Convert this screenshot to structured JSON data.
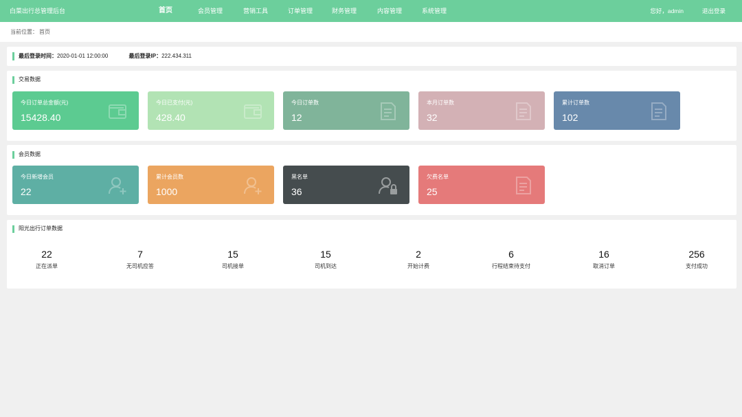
{
  "app": {
    "title": "白菜出行总管理后台"
  },
  "nav": {
    "items": [
      {
        "label": "首页",
        "active": true
      },
      {
        "label": "会员管理"
      },
      {
        "label": "营销工具"
      },
      {
        "label": "订单管理"
      },
      {
        "label": "财务管理"
      },
      {
        "label": "内容管理"
      },
      {
        "label": "系统管理"
      }
    ]
  },
  "user": {
    "greeting": "您好，admin",
    "logout": "退出登录"
  },
  "breadcrumb": {
    "label": "当前位置：",
    "current": "首页"
  },
  "login_info": {
    "time_label": "最后登录时间：",
    "time_value": "2020-01-01 12:00:00",
    "ip_label": "最后登录IP：",
    "ip_value": "222.434.311"
  },
  "trade": {
    "title": "交易数据",
    "cards": [
      {
        "label": "今日订单总金额(元)",
        "value": "15428.40",
        "color": "#5ccb91",
        "icon": "wallet-icon"
      },
      {
        "label": "今日已支付(元)",
        "value": "428.40",
        "color": "#b2e3b4",
        "icon": "wallet-icon"
      },
      {
        "label": "今日订单数",
        "value": "12",
        "color": "#80b49a",
        "icon": "document-icon"
      },
      {
        "label": "本月订单数",
        "value": "32",
        "color": "#d3b1b5",
        "icon": "document-icon"
      },
      {
        "label": "累计订单数",
        "value": "102",
        "color": "#6889ab",
        "icon": "document-icon"
      }
    ]
  },
  "member": {
    "title": "会员数据",
    "cards": [
      {
        "label": "今日新增会员",
        "value": "22",
        "color": "#5eafa4",
        "icon": "user-add-icon"
      },
      {
        "label": "累计会员数",
        "value": "1000",
        "color": "#eba560",
        "icon": "user-add-icon"
      },
      {
        "label": "黑名单",
        "value": "36",
        "color": "#454c4e",
        "icon": "user-lock-icon"
      },
      {
        "label": "欠费名单",
        "value": "25",
        "color": "#e57a7a",
        "icon": "document-icon"
      }
    ]
  },
  "orders": {
    "title": "阳光出行订单数据",
    "stats": [
      {
        "value": "22",
        "label": "正在派单"
      },
      {
        "value": "7",
        "label": "无司机应答"
      },
      {
        "value": "15",
        "label": "司机接单"
      },
      {
        "value": "15",
        "label": "司机到达"
      },
      {
        "value": "2",
        "label": "开始计费"
      },
      {
        "value": "6",
        "label": "行程结束待支付"
      },
      {
        "value": "16",
        "label": "取消订单"
      },
      {
        "value": "256",
        "label": "支付成功"
      }
    ]
  }
}
